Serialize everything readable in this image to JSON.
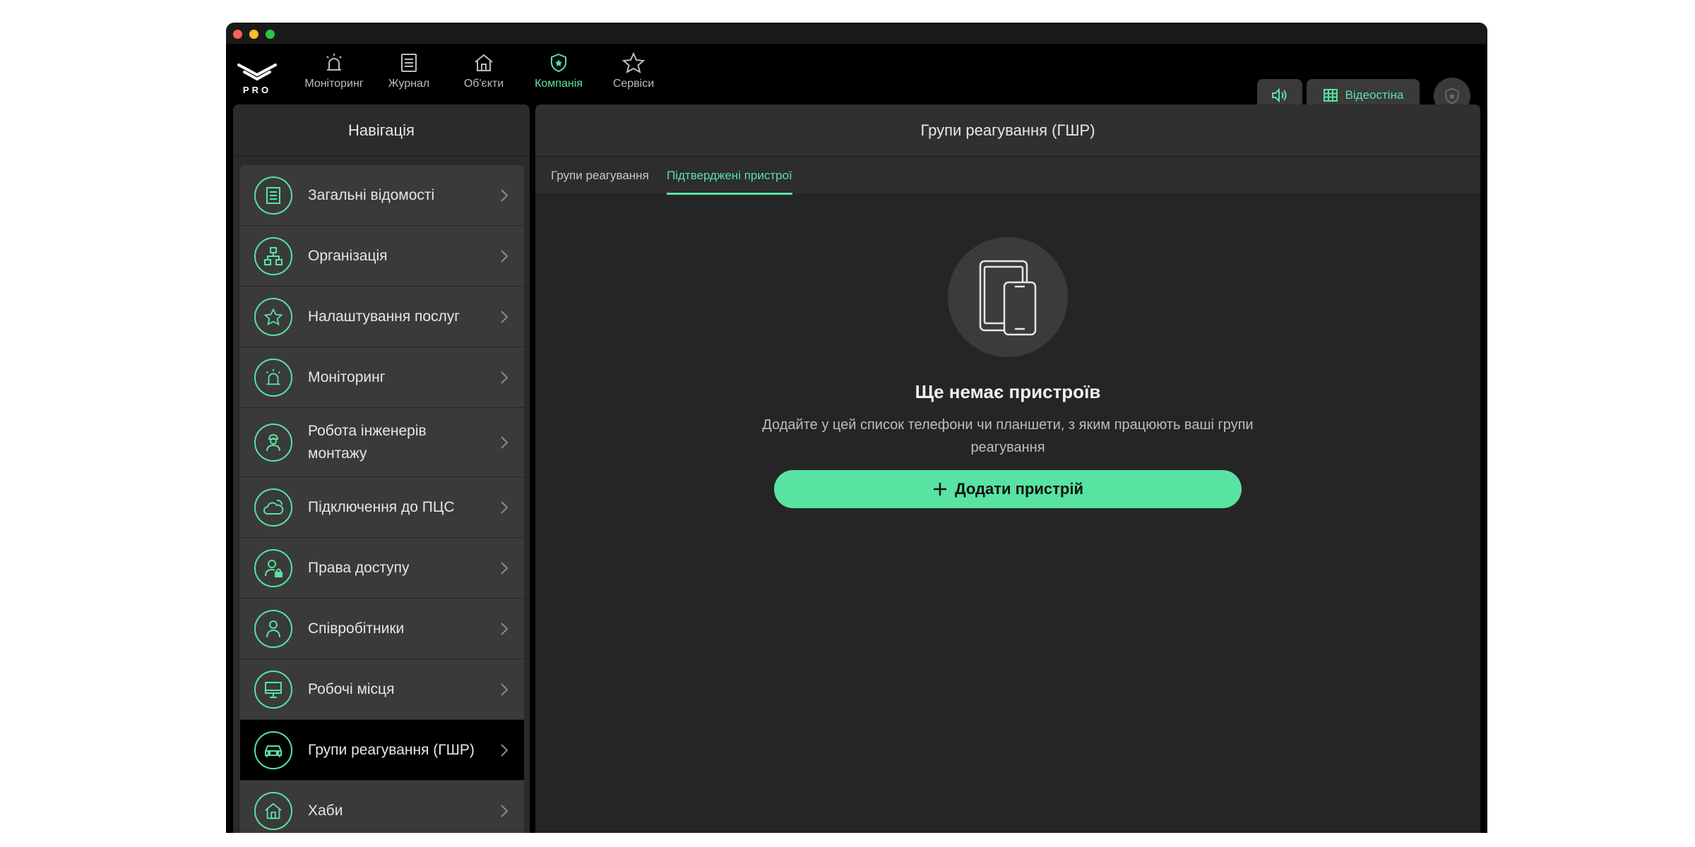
{
  "app": {
    "logo_text": "PRO"
  },
  "topnav": [
    {
      "label": "Моніторинг",
      "icon": "alarm-icon",
      "active": false
    },
    {
      "label": "Журнал",
      "icon": "journal-icon",
      "active": false
    },
    {
      "label": "Об'єкти",
      "icon": "house-icon",
      "active": false
    },
    {
      "label": "Компанія",
      "icon": "shield-star-icon",
      "active": true
    },
    {
      "label": "Сервіси",
      "icon": "star-icon",
      "active": false
    }
  ],
  "toolbar": {
    "video_label": "Відеостіна"
  },
  "left": {
    "title": "Навігація",
    "items": [
      {
        "label": "Загальні відомості",
        "icon": "document-icon"
      },
      {
        "label": "Організація",
        "icon": "org-chart-icon"
      },
      {
        "label": "Налаштування послуг",
        "icon": "star-icon"
      },
      {
        "label": "Моніторинг",
        "icon": "alarm-icon"
      },
      {
        "label": "Робота інженерів монтажу",
        "icon": "engineer-icon"
      },
      {
        "label": "Підключення до ПЦС",
        "icon": "cloud-icon"
      },
      {
        "label": "Права доступу",
        "icon": "user-lock-icon"
      },
      {
        "label": "Співробітники",
        "icon": "user-icon"
      },
      {
        "label": "Робочі місця",
        "icon": "monitor-icon"
      },
      {
        "label": "Групи реагування (ГШР)",
        "icon": "car-icon"
      },
      {
        "label": "Хаби",
        "icon": "hub-icon"
      }
    ]
  },
  "main": {
    "title": "Групи реагування (ГШР)",
    "tabs": [
      {
        "label": "Групи реагування",
        "active": false
      },
      {
        "label": "Підтверджені пристрої",
        "active": true
      }
    ],
    "empty": {
      "title": "Ще немає пристроїв",
      "description": "Додайте у цей список телефони чи планшети, з яким працюють ваші групи реагування",
      "button_label": "Додати пристрій"
    }
  },
  "colors": {
    "accent": "#58e3a3",
    "panel": "#2b2b2b",
    "item": "#3a3a3a"
  }
}
